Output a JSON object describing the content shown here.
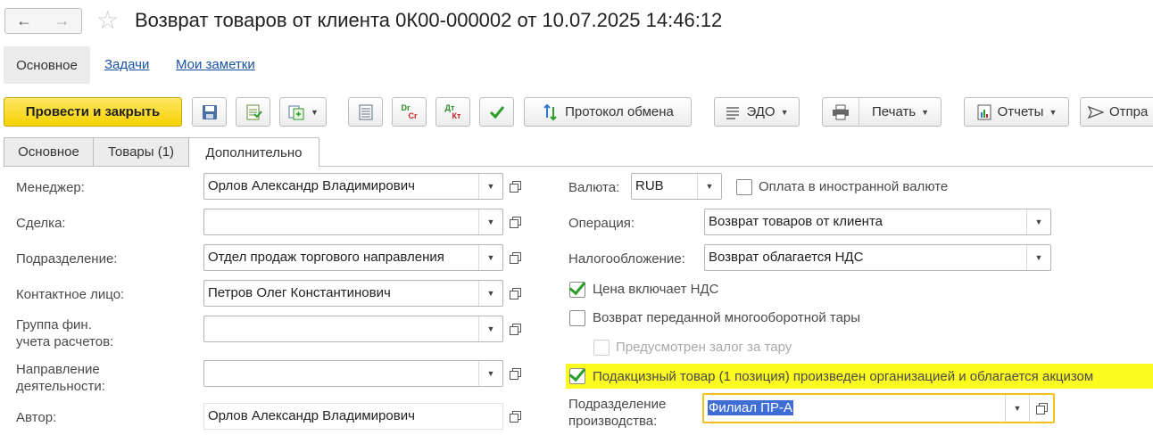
{
  "window": {
    "title": "Возврат товаров от клиента 0К00-000002 от 10.07.2025 14:46:12"
  },
  "topnav": {
    "items": [
      "Основное",
      "Задачи",
      "Мои заметки"
    ]
  },
  "toolbar": {
    "post_close_label": "Провести и закрыть",
    "exchange_log_label": "Протокол обмена",
    "edo_label": "ЭДО",
    "print_label": "Печать",
    "reports_label": "Отчеты",
    "send_label": "Отпра",
    "dr_cr": {
      "top": "Dr",
      "bottom": "Cr"
    },
    "dt_kt": {
      "top": "Дт",
      "bottom": "Кт"
    }
  },
  "tabs": [
    "Основное",
    "Товары (1)",
    "Дополнительно"
  ],
  "active_tab": "Дополнительно",
  "left_form": {
    "manager": {
      "label": "Менеджер:",
      "value": "Орлов Александр Владимирович"
    },
    "deal": {
      "label": "Сделка:",
      "value": ""
    },
    "department": {
      "label": "Подразделение:",
      "value": "Отдел продаж торгового направления"
    },
    "contact": {
      "label": "Контактное лицо:",
      "value": "Петров Олег Константинович"
    },
    "fin_group": {
      "label_line1": "Группа фин.",
      "label_line2": "учета расчетов:",
      "value": ""
    },
    "direction": {
      "label_line1": "Направление",
      "label_line2": "деятельности:",
      "value": ""
    },
    "author": {
      "label": "Автор:",
      "value": "Орлов Александр Владимирович"
    }
  },
  "right_form": {
    "currency": {
      "label": "Валюта:",
      "value": "RUB"
    },
    "foreign_payment": {
      "label": "Оплата в иностранной валюте",
      "checked": false
    },
    "operation": {
      "label": "Операция:",
      "value": "Возврат товаров от клиента"
    },
    "taxation": {
      "label": "Налогообложение:",
      "value": "Возврат облагается НДС"
    },
    "price_incl_vat": {
      "label": "Цена включает НДС",
      "checked": true
    },
    "returnable_packaging": {
      "label": "Возврат переданной многооборотной тары",
      "checked": false
    },
    "packaging_deposit": {
      "label": "Предусмотрен залог за тару",
      "checked": false,
      "disabled": true
    },
    "excise_goods": {
      "label": "Подакцизный товар (1 позиция) произведен организацией и облагается акцизом",
      "checked": true,
      "highlighted": true
    },
    "production_dept": {
      "label_line1": "Подразделение",
      "label_line2": "производства:",
      "value": "Филиал ПР-А"
    }
  },
  "colors": {
    "accent_yellow": "#f5d200",
    "link_blue": "#1a52a5",
    "highlight": "#fbfb1f",
    "selection": "#3f6dd6",
    "check_green": "#2a9d2a"
  }
}
